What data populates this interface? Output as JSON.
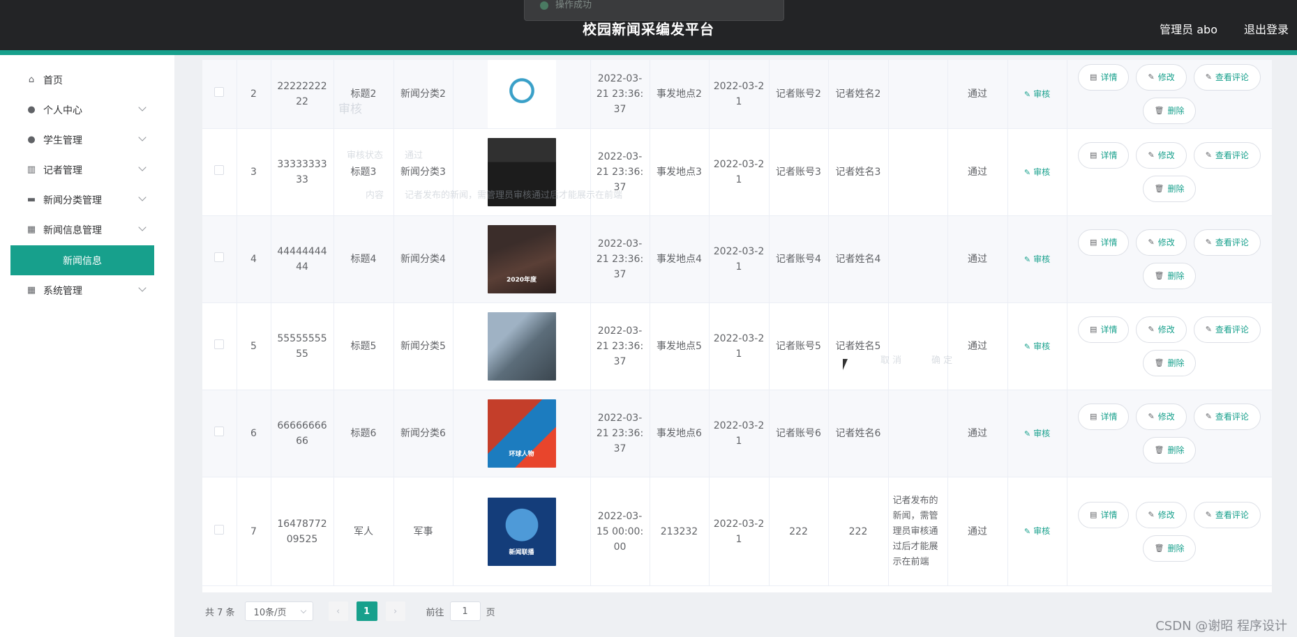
{
  "header": {
    "title": "校园新闻采编发平台",
    "user": "管理员 abo",
    "logout": "退出登录",
    "toast": "操作成功"
  },
  "sidebar": {
    "items": [
      {
        "label": "首页",
        "icon": "home-icon",
        "glyph": "⌂"
      },
      {
        "label": "个人中心",
        "icon": "user-icon",
        "glyph": "●"
      },
      {
        "label": "学生管理",
        "icon": "student-icon",
        "glyph": "●"
      },
      {
        "label": "记者管理",
        "icon": "reporter-icon",
        "glyph": "▥"
      },
      {
        "label": "新闻分类管理",
        "icon": "monitor-icon",
        "glyph": "▬"
      },
      {
        "label": "新闻信息管理",
        "icon": "grid-icon",
        "glyph": "▦"
      },
      {
        "label": "系统管理",
        "icon": "grid-icon",
        "glyph": "▦"
      }
    ],
    "active_sub": "新闻信息"
  },
  "ghost_dialog": {
    "title": "审核",
    "status_label": "审核状态",
    "status_value": "通过",
    "content_label": "内容",
    "content_value": "记者发布的新闻，需管理员审核通过后才能展示在前端",
    "cancel": "取 消",
    "confirm": "确 定"
  },
  "table": {
    "rows": [
      {
        "idx": "2",
        "no": "2222222222",
        "title": "标题2",
        "category": "新闻分类2",
        "time": "2022-03-21 23:36:37",
        "place": "事发地点2",
        "date": "2022-03-21",
        "account": "记者账号2",
        "name": "记者姓名2",
        "reply": "",
        "status": "通过"
      },
      {
        "idx": "3",
        "no": "3333333333",
        "title": "标题3",
        "category": "新闻分类3",
        "time": "2022-03-21 23:36:37",
        "place": "事发地点3",
        "date": "2022-03-21",
        "account": "记者账号3",
        "name": "记者姓名3",
        "reply": "",
        "status": "通过"
      },
      {
        "idx": "4",
        "no": "4444444444",
        "title": "标题4",
        "category": "新闻分类4",
        "time": "2022-03-21 23:36:37",
        "place": "事发地点4",
        "date": "2022-03-21",
        "account": "记者账号4",
        "name": "记者姓名4",
        "reply": "",
        "status": "通过"
      },
      {
        "idx": "5",
        "no": "5555555555",
        "title": "标题5",
        "category": "新闻分类5",
        "time": "2022-03-21 23:36:37",
        "place": "事发地点5",
        "date": "2022-03-21",
        "account": "记者账号5",
        "name": "记者姓名5",
        "reply": "",
        "status": "通过"
      },
      {
        "idx": "6",
        "no": "6666666666",
        "title": "标题6",
        "category": "新闻分类6",
        "time": "2022-03-21 23:36:37",
        "place": "事发地点6",
        "date": "2022-03-21",
        "account": "记者账号6",
        "name": "记者姓名6",
        "reply": "",
        "status": "通过"
      },
      {
        "idx": "7",
        "no": "1647877209525",
        "title": "军人",
        "category": "军事",
        "time": "2022-03-15 00:00:00",
        "place": "213232",
        "date": "2022-03-21",
        "account": "222",
        "name": "222",
        "reply": "记者发布的新闻，需管理员审核通过后才能展示在前端",
        "status": "通过"
      }
    ],
    "thumb_texts": [
      "",
      "",
      "2020年度",
      "",
      "环球人物",
      "新闻联播"
    ],
    "audit_label": "审核",
    "btn_detail": "详情",
    "btn_edit": "修改",
    "btn_comment": "查看评论",
    "btn_delete": "删除"
  },
  "pager": {
    "total": "共 7 条",
    "size": "10条/页",
    "current": "1",
    "goto_prefix": "前往",
    "goto_value": "1",
    "goto_suffix": "页"
  },
  "watermark": "CSDN @谢昭  程序设计"
}
